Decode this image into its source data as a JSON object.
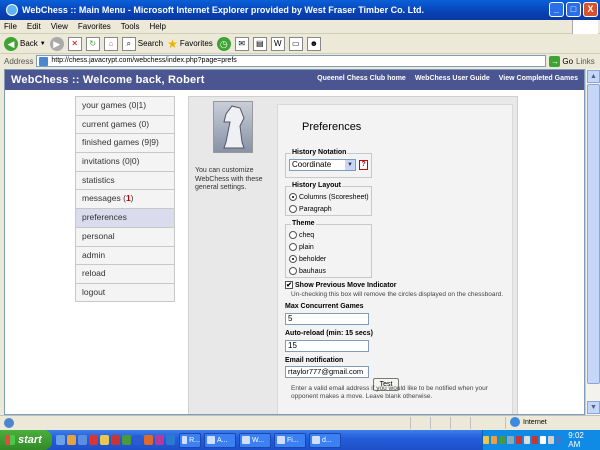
{
  "window": {
    "title": "WebChess :: Main Menu - Microsoft Internet Explorer provided by West Fraser Timber Co. Ltd.",
    "min": "_",
    "max": "□",
    "close": "X"
  },
  "menu": [
    "File",
    "Edit",
    "View",
    "Favorites",
    "Tools",
    "Help"
  ],
  "toolbar": {
    "back": "Back",
    "search": "Search",
    "favorites": "Favorites"
  },
  "address": {
    "label": "Address",
    "url": "http://chess.javacrypt.com/webchess/index.php?page=prefs",
    "go": "Go",
    "links": "Links"
  },
  "site": {
    "title": "WebChess :: Welcome back, Robert",
    "links": [
      "Queenel Chess Club home",
      "WebChess User Guide",
      "View Completed Games"
    ]
  },
  "sidenav": [
    {
      "label": "your games (0|1)"
    },
    {
      "label": "current games (0)"
    },
    {
      "label": "finished games (9|9)"
    },
    {
      "label": "invitations (0|0)"
    },
    {
      "label": "statistics"
    },
    {
      "label": "messages (",
      "count": "1",
      "suffix": ")"
    },
    {
      "label": "preferences",
      "active": true
    },
    {
      "label": "personal"
    },
    {
      "label": "admin"
    },
    {
      "label": "reload"
    },
    {
      "label": "logout"
    }
  ],
  "panel": {
    "description": "You can customize WebChess with these general settings.",
    "heading": "Preferences",
    "history_notation": {
      "legend": "History Notation",
      "value": "Coordinate",
      "help": "?"
    },
    "history_layout": {
      "legend": "History Layout",
      "options": [
        "Columns (Scoresheet)",
        "Paragraph"
      ],
      "selected": "Columns (Scoresheet)"
    },
    "theme": {
      "legend": "Theme",
      "options": [
        "cheq",
        "plain",
        "beholder",
        "bauhaus"
      ],
      "selected": "beholder"
    },
    "show_previous": {
      "label": "Show Previous Move Indicator",
      "checked": true,
      "check": "✔",
      "note": "Un-checking this box will remove the circles displayed on the chessboard."
    },
    "max_games": {
      "label": "Max Concurrent Games",
      "value": "5"
    },
    "auto_reload": {
      "label": "Auto-reload (min: 15 secs)",
      "value": "15"
    },
    "email": {
      "label": "Email notification",
      "value": "rtaylor777@gmail.com",
      "button": "Test",
      "note": "Enter a valid email address if you would like to be notified when your opponent makes a move. Leave blank otherwise."
    }
  },
  "statusbar": {
    "zone": "Internet"
  },
  "taskbar": {
    "start": "start",
    "tasks": [
      "R...",
      "A...",
      "W...",
      "Fi...",
      "d..."
    ],
    "clock": "9:02 AM"
  }
}
